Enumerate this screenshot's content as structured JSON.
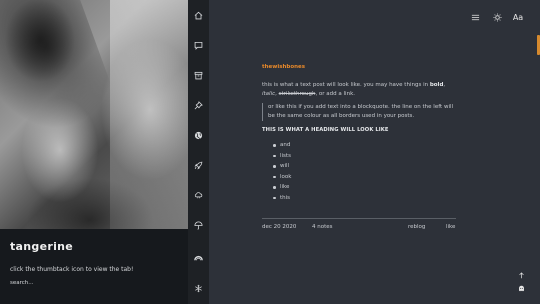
{
  "blog": {
    "title": "tangerine",
    "description": "click the thumbtack icon to view the tab!",
    "search_label": "search..."
  },
  "nav": {
    "icons": [
      "home-icon",
      "message-icon",
      "archive-icon",
      "thumbtack-icon",
      "globe-icon",
      "rocket-icon",
      "cloud-icon",
      "umbrella-icon",
      "rainbow-icon",
      "snowflake-icon"
    ]
  },
  "toolbar": {
    "menu_icon": "menu-icon",
    "theme_icon": "sun-icon",
    "font_label": "Aa"
  },
  "accent_color": "#e8892a",
  "post": {
    "author": "thewishbones",
    "body_line1_start": "this is what a text post will look like. you may have things in ",
    "bold": "bold",
    "body_line1_end": ",",
    "italic": "italic",
    "sep1": ", ",
    "strikethrough": "strikethrough",
    "sep2": ", or add a ",
    "link": "link",
    "end": ".",
    "quote": "or like this if you add text into a blockquote. the line on the left will be the same colour as all borders used in your posts.",
    "heading": "THIS IS WHAT A HEADING WILL LOOK LIKE",
    "list": [
      "and",
      "lists",
      "will",
      "look",
      "like",
      "this"
    ],
    "date": "dec 20 2020",
    "notes": "4 notes",
    "reblog_label": "reblog",
    "like_label": "like"
  },
  "bottom": {
    "icons": [
      "arrow-up-icon",
      "ghost-icon"
    ]
  }
}
